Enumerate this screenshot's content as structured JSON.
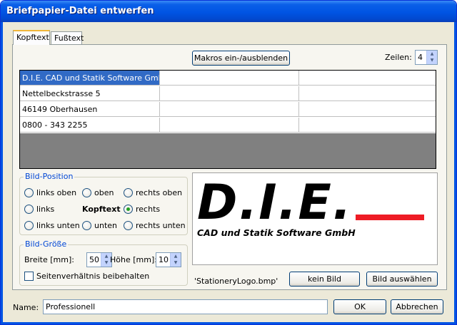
{
  "window": {
    "title": "Briefpapier-Datei entwerfen"
  },
  "tabs": [
    {
      "label": "Kopftext",
      "active": true
    },
    {
      "label": "Fußtext",
      "active": false
    }
  ],
  "toolbar": {
    "macros_button": "Makros ein-/ausblenden",
    "rows_label": "Zeilen:",
    "rows_value": "4"
  },
  "grid": {
    "rows": [
      [
        "D.I.E. CAD und Statik Software GmbH",
        "",
        ""
      ],
      [
        "Nettelbeckstrasse 5",
        "",
        ""
      ],
      [
        "46149 Oberhausen",
        "",
        ""
      ],
      [
        "0800 - 343 2255",
        "",
        ""
      ]
    ],
    "selected_cell": "D.I.E. CAD und Statik Software GmbH"
  },
  "bild_position": {
    "title": "Bild-Position",
    "options": {
      "links_oben": "links oben",
      "oben": "oben",
      "rechts_oben": "rechts oben",
      "links": "links",
      "center": "Kopftext",
      "rechts": "rechts",
      "links_unten": "links unten",
      "unten": "unten",
      "rechts_unten": "rechts unten"
    },
    "selected": "rechts"
  },
  "bild_groesse": {
    "title": "Bild-Größe",
    "breite_label": "Breite [mm]:",
    "breite_value": "50",
    "hoehe_label": "Höhe [mm]:",
    "hoehe_value": "10",
    "aspect_label": "Seitenverhältnis beibehalten",
    "aspect_checked": false
  },
  "image": {
    "logo_text": "D.I.E.",
    "logo_subtitle": "CAD und Statik Software GmbH",
    "filename": "'StationeryLogo.bmp'",
    "no_image_button": "kein Bild",
    "choose_image_button": "Bild auswählen",
    "logo_red": "#ee1c25",
    "logo_black": "#000000"
  },
  "footer": {
    "name_label": "Name:",
    "name_value": "Professionell",
    "ok_button": "OK",
    "cancel_button": "Abbrechen"
  }
}
